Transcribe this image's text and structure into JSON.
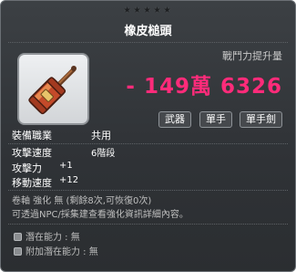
{
  "item": {
    "stars": "★★★★★",
    "name": "橡皮槌頭",
    "icon": "rubber-mallet-icon"
  },
  "power": {
    "label": "戰鬥力提升量",
    "value": "- 149萬 6326"
  },
  "tags": [
    "武器",
    "單手",
    "單手劍"
  ],
  "job": {
    "label": "裝備職業",
    "value": "共用"
  },
  "stats": [
    {
      "label": "攻擊速度",
      "value": "6階段"
    },
    {
      "label": "攻擊力",
      "value": "+1"
    },
    {
      "label": "移動速度",
      "value": "+12"
    }
  ],
  "info": {
    "line1": "卷軸 強化 無 (剩餘8次,可恢復0次)",
    "line2": "可透過NPC/採集建查看強化資訊詳細內容。"
  },
  "potential": {
    "line1": "潛在能力 : 無",
    "line2": "附加潛在能力 : 無"
  },
  "colors": {
    "power": "#ff2b7a",
    "background": "#35383c"
  }
}
